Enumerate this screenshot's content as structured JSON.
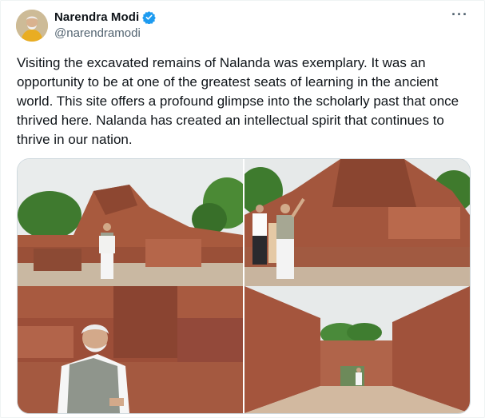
{
  "tweet": {
    "author_name": "Narendra Modi",
    "handle": "@narendramodi",
    "text": "Visiting the excavated remains of Nalanda was exemplary. It was an opportunity to be at one of the greatest seats of learning in the ancient world. This site offers a profound glimpse into the scholarly past that once thrived here. Nalanda has created an intellectual spirit that continues to thrive in our nation.",
    "more_symbol": "···"
  },
  "icons": {
    "verified": "verified-badge-icon",
    "more": "more-options-icon"
  },
  "colors": {
    "verified_blue": "#1d9bf0",
    "handle_gray": "#536471",
    "text": "#0f1419",
    "brick": "#a4573f",
    "sky": "#eef0f0",
    "foliage": "#3d7a2d"
  },
  "media": [
    {
      "description_name": "photo-ruins-front"
    },
    {
      "description_name": "photo-ruins-group"
    },
    {
      "description_name": "photo-closeup"
    },
    {
      "description_name": "photo-corridor"
    }
  ]
}
